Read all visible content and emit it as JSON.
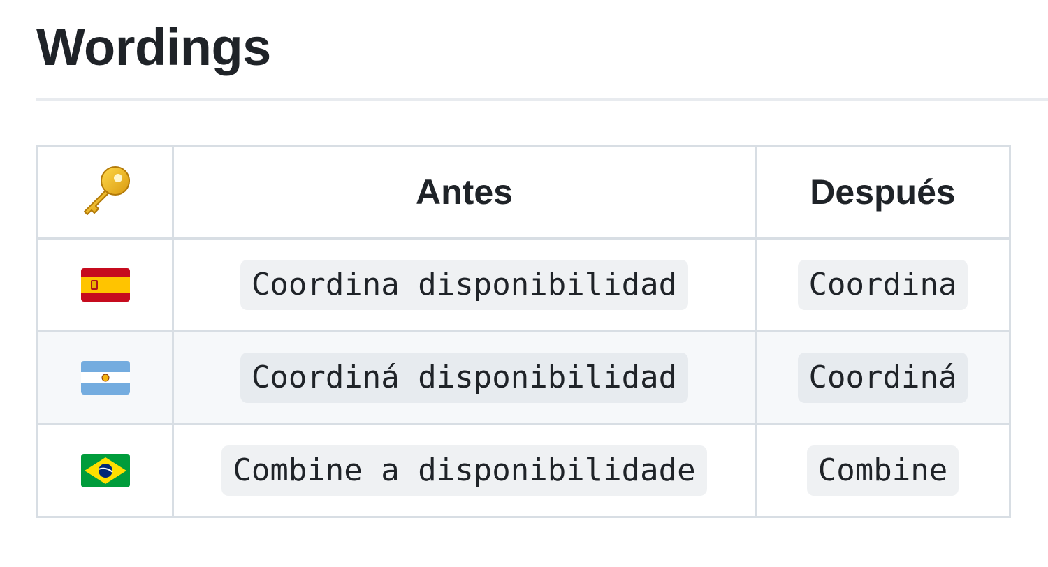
{
  "heading": "Wordings",
  "table": {
    "header": {
      "icon": "key-icon",
      "before": "Antes",
      "after": "Después"
    },
    "rows": [
      {
        "flag": "spain-flag-icon",
        "before": "Coordina disponibilidad",
        "after": "Coordina"
      },
      {
        "flag": "argentina-flag-icon",
        "before": "Coordiná disponibilidad",
        "after": "Coordiná"
      },
      {
        "flag": "brazil-flag-icon",
        "before": "Combine a disponibilidade",
        "after": "Combine"
      }
    ]
  },
  "colors": {
    "border": "#d8dee4",
    "alt_row": "#f6f8fa",
    "code_bg": "#eceef1",
    "text": "#1f2328"
  }
}
